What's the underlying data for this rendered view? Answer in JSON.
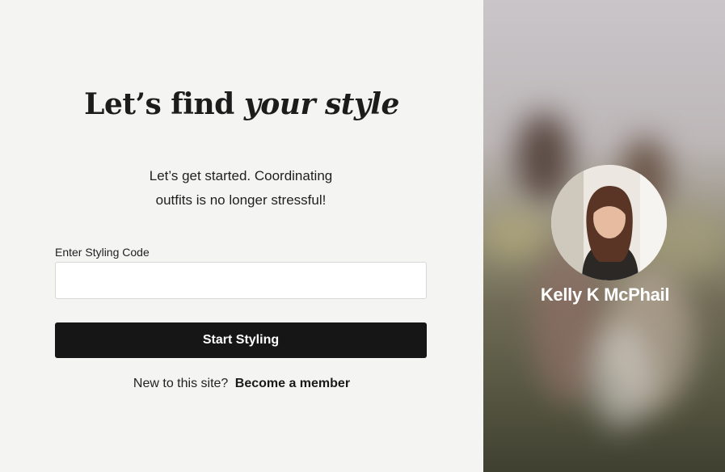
{
  "headline": {
    "part1": "Let’s find",
    "part2": "your style"
  },
  "subtitle": {
    "line1": "Let’s get started. Coordinating",
    "line2": "outfits is no longer stressful!"
  },
  "form": {
    "code_label": "Enter Styling Code",
    "code_value": "",
    "code_placeholder": "",
    "submit_label": "Start Styling"
  },
  "signup": {
    "prompt": "New to this site?",
    "link_label": "Become a member"
  },
  "stylist": {
    "name": "Kelly K McPhail"
  },
  "colors": {
    "button": "#161616",
    "background": "#f4f4f2",
    "text": "#1a1a1a"
  }
}
